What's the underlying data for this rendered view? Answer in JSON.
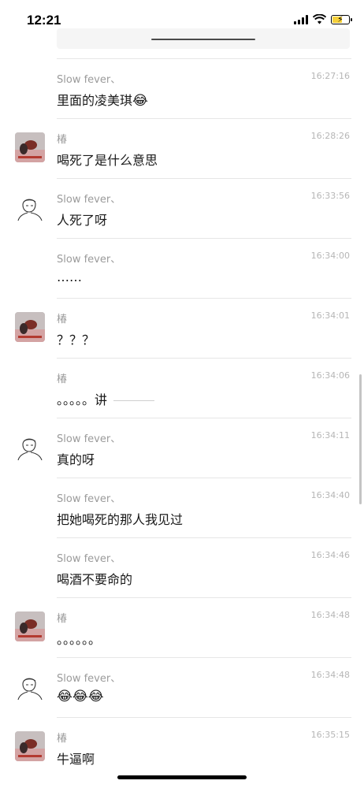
{
  "status_bar": {
    "time": "12:21"
  },
  "messages": [
    {
      "sender": "Slow fever、",
      "time": "16:27:16",
      "text": "里面的凌美琪",
      "emoji": "😂",
      "avatar": "none"
    },
    {
      "sender": "椿",
      "time": "16:28:26",
      "text": "喝死了是什么意思",
      "avatar": "photo"
    },
    {
      "sender": "Slow fever、",
      "time": "16:33:56",
      "text": "人死了呀",
      "avatar": "sketch"
    },
    {
      "sender": "Slow fever、",
      "time": "16:34:00",
      "text": "……",
      "avatar": "none"
    },
    {
      "sender": "椿",
      "time": "16:34:01",
      "text": "？？？",
      "avatar": "photo"
    },
    {
      "sender": "椿",
      "time": "16:34:06",
      "text": "。。。。。讲",
      "avatar": "none"
    },
    {
      "sender": "Slow fever、",
      "time": "16:34:11",
      "text": "真的呀",
      "avatar": "sketch"
    },
    {
      "sender": "Slow fever、",
      "time": "16:34:40",
      "text": "把她喝死的那人我见过",
      "avatar": "none"
    },
    {
      "sender": "Slow fever、",
      "time": "16:34:46",
      "text": "喝酒不要命的",
      "avatar": "none"
    },
    {
      "sender": "椿",
      "time": "16:34:48",
      "text": "。。。。。。",
      "avatar": "photo"
    },
    {
      "sender": "Slow fever、",
      "time": "16:34:48",
      "text": "",
      "emoji": "😂😂😂",
      "avatar": "sketch"
    },
    {
      "sender": "椿",
      "time": "16:35:15",
      "text": "牛逼啊",
      "avatar": "photo"
    }
  ]
}
